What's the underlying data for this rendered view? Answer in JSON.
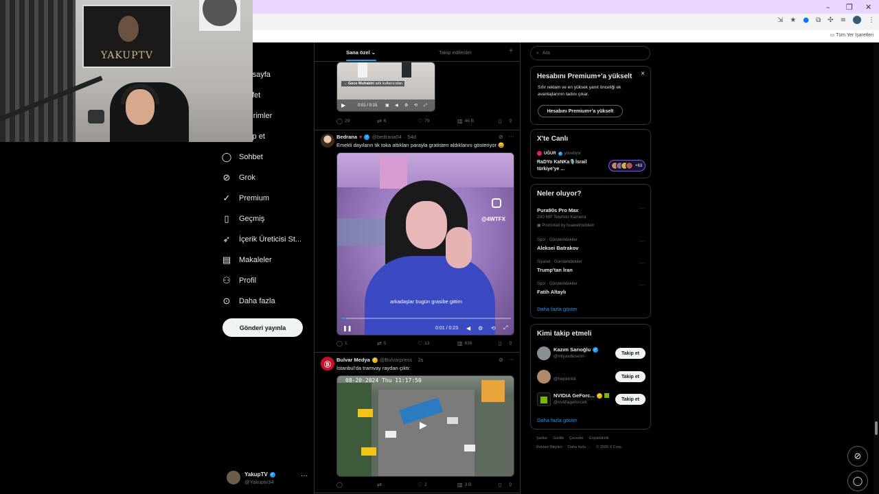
{
  "browser": {
    "window_controls": [
      "–",
      "❐",
      "✕"
    ],
    "bookmarks_all": "Tüm Yer İşaretleri"
  },
  "webcam": {
    "poster_text": "YAKUPTV"
  },
  "nav": {
    "items": [
      {
        "label": "Anasayfa",
        "icon": "home-icon"
      },
      {
        "label": "Keşfet",
        "icon": "search-icon"
      },
      {
        "label": "Bildirimler",
        "icon": "bell-icon"
      },
      {
        "label": "Takip et",
        "icon": "follow-icon"
      },
      {
        "label": "Sohbet",
        "icon": "chat-icon"
      },
      {
        "label": "Grok",
        "icon": "grok-icon"
      },
      {
        "label": "Premium",
        "icon": "premium-icon"
      },
      {
        "label": "Geçmiş",
        "icon": "bookmark-icon"
      },
      {
        "label": "İçerik Üreticisi St...",
        "icon": "rocket-icon"
      },
      {
        "label": "Makaleler",
        "icon": "article-icon"
      },
      {
        "label": "Profil",
        "icon": "person-icon"
      },
      {
        "label": "Daha fazla",
        "icon": "more-circle-icon"
      }
    ],
    "post_button": "Gönderi yayınla",
    "account": {
      "name": "YakupTV",
      "handle": "@Yakuptv34",
      "more": "···"
    }
  },
  "timeline": {
    "tabs": [
      {
        "label": "Sana özel",
        "active": true
      },
      {
        "label": "Takip edilenler",
        "active": false
      }
    ],
    "tabs_plus": "+",
    "tweet0": {
      "caption_prefix": "→",
      "caption_name": "Gece Muhabiri",
      "caption_suffix": "adlı kullanıcıdan",
      "video_time": "0:01 / 0:15",
      "actions": {
        "replies": "29",
        "reposts": "8",
        "likes": "79",
        "views": "46 B"
      }
    },
    "tweet1": {
      "name": "Bedrana",
      "handle": "@bedrana04",
      "time": "54d",
      "text": "Emekli dayıların tik toka attıkları parayla gratisten aldıklarını gösteriyor 😄",
      "video_watermark": "@4WTFX",
      "subtitle": "arkadaşlar bugün grasibe gittim",
      "video_time": "0:01 / 0:23",
      "actions": {
        "replies": "1",
        "reposts": "5",
        "likes": "13",
        "views": "638"
      }
    },
    "tweet2": {
      "name": "Bulvar Medya",
      "handle": "@Bulvarpress",
      "time": "2s",
      "text": "İstanbul'da tramvay raydan çıktı:",
      "cctv_stamp": "08-20-2024 Thu 11:17:50",
      "actions": {
        "replies": "",
        "reposts": "",
        "likes": "2",
        "views": "3 B"
      }
    }
  },
  "right": {
    "search_placeholder": "Ara",
    "premium": {
      "title": "Hesabını Premium+'a yükselt",
      "body_line1": "Sıfır reklam ve en yüksek yanıt önceliği ek",
      "body_line2": "avantajlarının tadını çıkar.",
      "button": "Hesabını Premium+'a yükselt",
      "close": "×"
    },
    "live": {
      "title": "X'te Canlı",
      "host": "UĞUR",
      "host_status": "yönetiyor",
      "line1": "RaDYo KaNKa🎙️İsrail",
      "line2": "türkiye'ye ...",
      "listeners": "+63"
    },
    "trends": {
      "title": "Neler oluyor?",
      "items": [
        {
          "context": "",
          "name": "Pura90s Pro Max",
          "sub": "200 MP Telefoto Kamera",
          "promo": "Promoted by huaweimobiletr"
        },
        {
          "context": "Spor · Gündemdekiler",
          "name": "Aleksei Batrakov"
        },
        {
          "context": "Siyaset · Gündemdekiler",
          "name": "Trump'tan İran"
        },
        {
          "context": "Spor · Gündemdekiler",
          "name": "Fatih Altaylı"
        }
      ],
      "more_link": "Daha fazla göster"
    },
    "who_to_follow": {
      "title": "Kimi takip etmeli",
      "items": [
        {
          "name": "Kazım Sarıoğlu",
          "handle": "@mlyavdesenn",
          "button": "Takip et"
        },
        {
          "name": "",
          "handle": "@hepkirildi",
          "button": "Takip et"
        },
        {
          "name": "NVIDIA GeForc...",
          "handle": "@nvidiageforcetr",
          "button": "Takip et"
        }
      ],
      "more_link": "Daha fazla göster"
    },
    "footer": {
      "row1": [
        "Şartlar",
        "Gizlilik",
        "Çerezler",
        "Erişilebilirlik"
      ],
      "row2": [
        "Reklam Bilgileri",
        "Daha fazla ···",
        "© 2026 X Corp."
      ]
    }
  },
  "colors": {
    "accent": "#1d9bf0",
    "background": "#000000",
    "border": "#2f3336",
    "muted": "#71767b"
  }
}
